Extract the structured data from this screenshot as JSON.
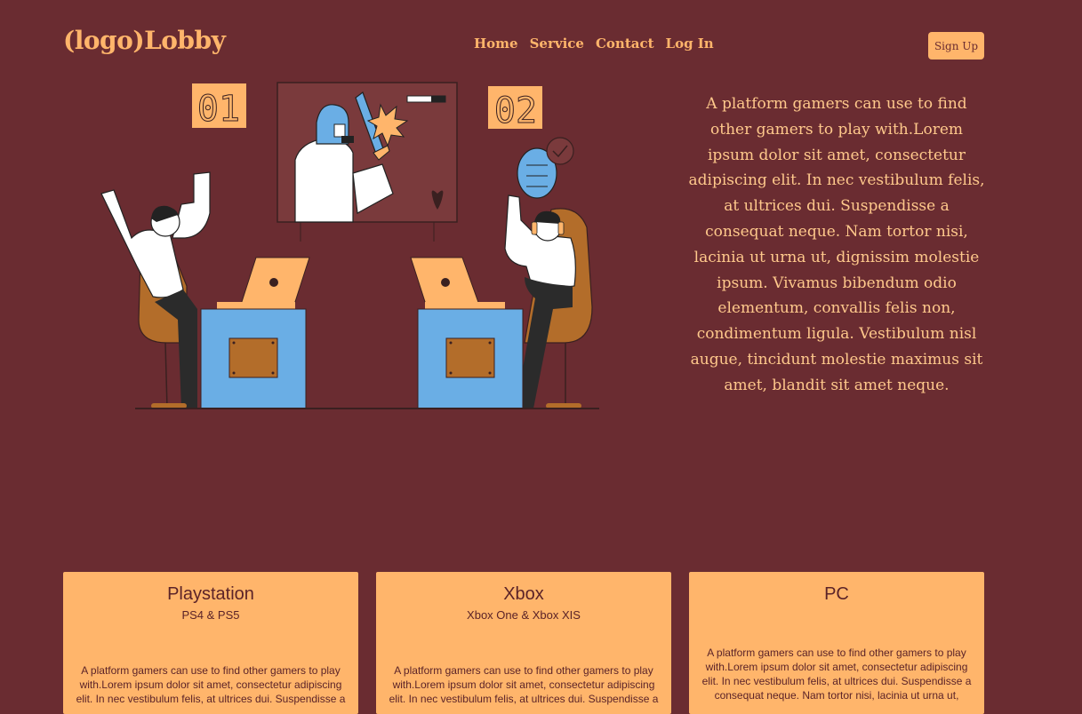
{
  "header": {
    "logo": "(logo)Lobby",
    "nav": [
      "Home",
      "Service",
      "Contact",
      "Log In"
    ],
    "signup_label": "Sign Up"
  },
  "hero": {
    "text": "A platform gamers can use to find other gamers to play with.Lorem ipsum dolor sit amet, consectetur adipiscing elit. In nec vestibulum felis, at ultrices dui. Suspendisse a consequat neque. Nam tortor nisi, lacinia ut urna ut, dignissim molestie ipsum. Vivamus bibendum odio elementum, convallis felis non, condimentum ligula. Vestibulum nisl augue, tincidunt molestie maximus sit amet, blandit sit amet neque.",
    "illustration": {
      "scoreboard_left": "01",
      "scoreboard_right": "02"
    }
  },
  "cards": [
    {
      "title": "Playstation",
      "subtitle": "PS4 & PS5",
      "desc": "A platform gamers can use to find other gamers to play with.Lorem ipsum dolor sit amet, consectetur adipiscing elit. In nec vestibulum felis, at ultrices dui. Suspendisse a"
    },
    {
      "title": "Xbox",
      "subtitle": "Xbox One & Xbox XIS",
      "desc": "A platform gamers can use to find other gamers to play with.Lorem ipsum dolor sit amet, consectetur adipiscing elit. In nec vestibulum felis, at ultrices dui. Suspendisse a"
    },
    {
      "title": "PC",
      "subtitle": "",
      "desc": "A platform gamers can use to find other gamers to play with.Lorem ipsum dolor sit amet, consectetur adipiscing elit. In nec vestibulum felis, at ultrices dui. Suspendisse a consequat neque. Nam tortor nisi, lacinia ut urna ut,"
    }
  ],
  "colors": {
    "background": "#6a2c31",
    "accent": "#ffb56b",
    "text_light": "#ffc98c"
  }
}
